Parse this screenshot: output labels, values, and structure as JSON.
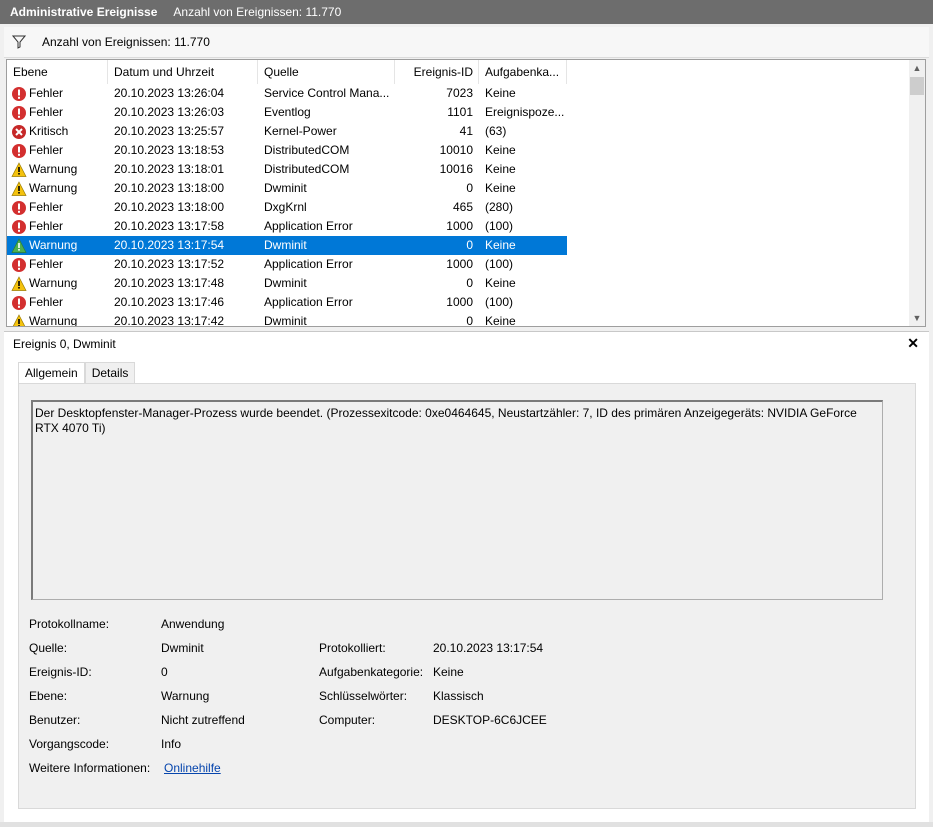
{
  "window": {
    "title": "Administrative Ereignisse",
    "count_text": "Anzahl von Ereignissen: 11.770"
  },
  "filter": {
    "icon": "filter-icon",
    "text": "Anzahl von Ereignissen: 11.770"
  },
  "table": {
    "columns": [
      "Ebene",
      "Datum und Uhrzeit",
      "Quelle",
      "Ereignis-ID",
      "Aufgabenka..."
    ],
    "rows": [
      {
        "level": "Fehler",
        "icon": "error-icon",
        "datetime": "20.10.2023 13:26:04",
        "source": "Service Control Mana...",
        "id": "7023",
        "task": "Keine"
      },
      {
        "level": "Fehler",
        "icon": "error-icon",
        "datetime": "20.10.2023 13:26:03",
        "source": "Eventlog",
        "id": "1101",
        "task": "Ereignispoze..."
      },
      {
        "level": "Kritisch",
        "icon": "critical-icon",
        "datetime": "20.10.2023 13:25:57",
        "source": "Kernel-Power",
        "id": "41",
        "task": "(63)"
      },
      {
        "level": "Fehler",
        "icon": "error-icon",
        "datetime": "20.10.2023 13:18:53",
        "source": "DistributedCOM",
        "id": "10010",
        "task": "Keine"
      },
      {
        "level": "Warnung",
        "icon": "warning-icon",
        "datetime": "20.10.2023 13:18:01",
        "source": "DistributedCOM",
        "id": "10016",
        "task": "Keine"
      },
      {
        "level": "Warnung",
        "icon": "warning-icon",
        "datetime": "20.10.2023 13:18:00",
        "source": "Dwminit",
        "id": "0",
        "task": "Keine"
      },
      {
        "level": "Fehler",
        "icon": "error-icon",
        "datetime": "20.10.2023 13:18:00",
        "source": "DxgKrnl",
        "id": "465",
        "task": "(280)"
      },
      {
        "level": "Fehler",
        "icon": "error-icon",
        "datetime": "20.10.2023 13:17:58",
        "source": "Application Error",
        "id": "1000",
        "task": "(100)"
      },
      {
        "level": "Warnung",
        "icon": "warning-icon",
        "datetime": "20.10.2023 13:17:54",
        "source": "Dwminit",
        "id": "0",
        "task": "Keine",
        "selected": true
      },
      {
        "level": "Fehler",
        "icon": "error-icon",
        "datetime": "20.10.2023 13:17:52",
        "source": "Application Error",
        "id": "1000",
        "task": "(100)"
      },
      {
        "level": "Warnung",
        "icon": "warning-icon",
        "datetime": "20.10.2023 13:17:48",
        "source": "Dwminit",
        "id": "0",
        "task": "Keine"
      },
      {
        "level": "Fehler",
        "icon": "error-icon",
        "datetime": "20.10.2023 13:17:46",
        "source": "Application Error",
        "id": "1000",
        "task": "(100)"
      },
      {
        "level": "Warnung",
        "icon": "warning-icon",
        "datetime": "20.10.2023 13:17:42",
        "source": "Dwminit",
        "id": "0",
        "task": "Keine"
      }
    ]
  },
  "detail": {
    "title": "Ereignis 0, Dwminit",
    "tabs": [
      "Allgemein",
      "Details"
    ],
    "message": "Der Desktopfenster-Manager-Prozess wurde beendet. (Prozessexitcode: 0xe0464645, Neustartzähler: 7, ID des primären Anzeigegeräts: NVIDIA GeForce RTX 4070 Ti)",
    "props": {
      "logname_label": "Protokollname:",
      "logname": "Anwendung",
      "source_label": "Quelle:",
      "source": "Dwminit",
      "logged_label": "Protokolliert:",
      "logged": "20.10.2023 13:17:54",
      "eventid_label": "Ereignis-ID:",
      "eventid": "0",
      "taskcat_label": "Aufgabenkategorie:",
      "taskcat": "Keine",
      "level_label": "Ebene:",
      "level": "Warnung",
      "keywords_label": "Schlüsselwörter:",
      "keywords": "Klassisch",
      "user_label": "Benutzer:",
      "user": "Nicht zutreffend",
      "computer_label": "Computer:",
      "computer": "DESKTOP-6C6JCEE",
      "opcode_label": "Vorgangscode:",
      "opcode": "Info",
      "moreinfo_label": "Weitere Informationen:",
      "moreinfo_link": "Onlinehilfe"
    }
  }
}
